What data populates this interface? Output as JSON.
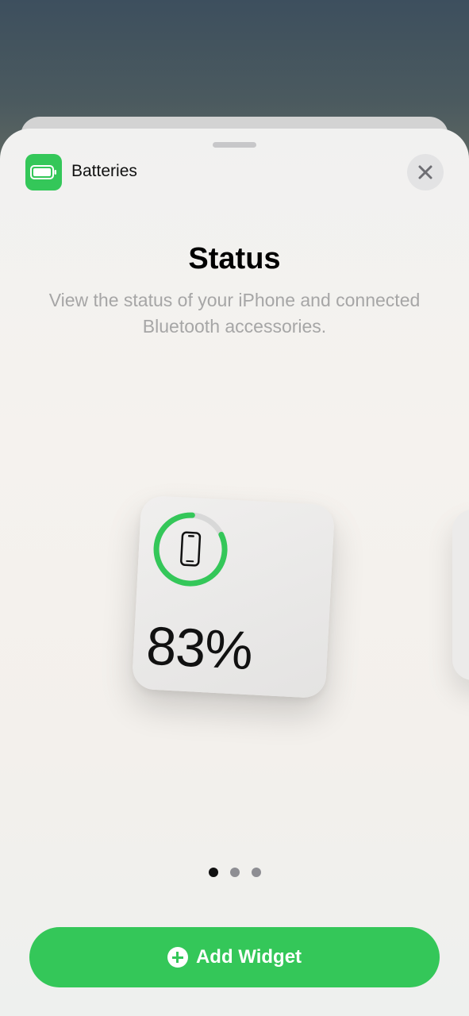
{
  "header": {
    "app_name": "Batteries",
    "app_icon": "battery-icon",
    "close_icon": "close-icon"
  },
  "content": {
    "title": "Status",
    "subtitle": "View the status of your iPhone and connected Bluetooth accessories."
  },
  "widget": {
    "device_icon": "iphone-icon",
    "battery_level": 0.83,
    "percent_label": "83%"
  },
  "pager": {
    "total_pages": 3,
    "current_page": 1
  },
  "action": {
    "add_label": "Add Widget",
    "add_icon": "plus-circle-icon"
  },
  "colors": {
    "accent_green": "#34c759",
    "ring_track": "#d8d8d8"
  }
}
